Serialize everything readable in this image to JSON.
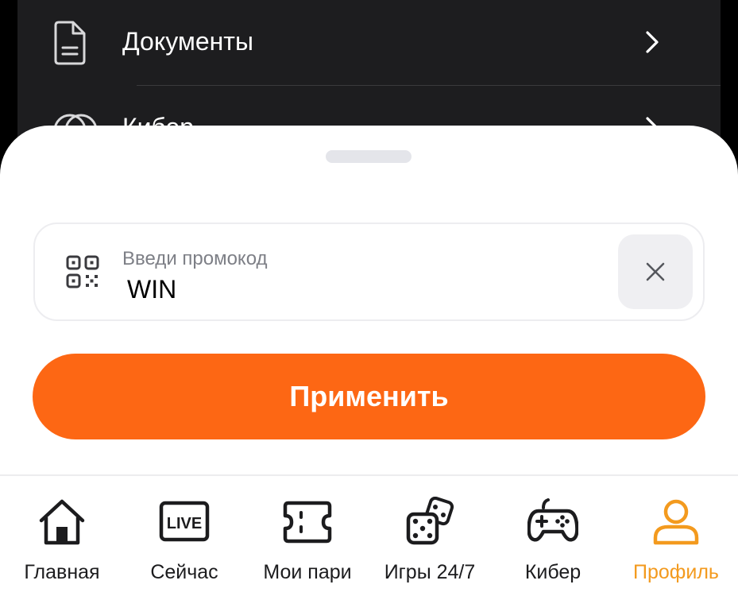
{
  "menu": {
    "items": [
      {
        "label": "Документы",
        "icon": "document-icon"
      },
      {
        "label": "Кибер",
        "icon": "coins-icon"
      }
    ]
  },
  "promo": {
    "placeholder": "Введи промокод",
    "value": "WIN",
    "apply_label": "Применить"
  },
  "tabs": [
    {
      "label": "Главная",
      "icon": "home-icon"
    },
    {
      "label": "Сейчас",
      "icon": "live-icon",
      "icon_text": "LIVE"
    },
    {
      "label": "Мои пари",
      "icon": "ticket-icon"
    },
    {
      "label": "Игры 24/7",
      "icon": "dice-icon"
    },
    {
      "label": "Кибер",
      "icon": "gamepad-icon"
    },
    {
      "label": "Профиль",
      "icon": "profile-icon",
      "active": true
    }
  ],
  "colors": {
    "accent": "#fd6714",
    "active_tab": "#f39a1e",
    "dark_bg": "#1d1d1f"
  }
}
